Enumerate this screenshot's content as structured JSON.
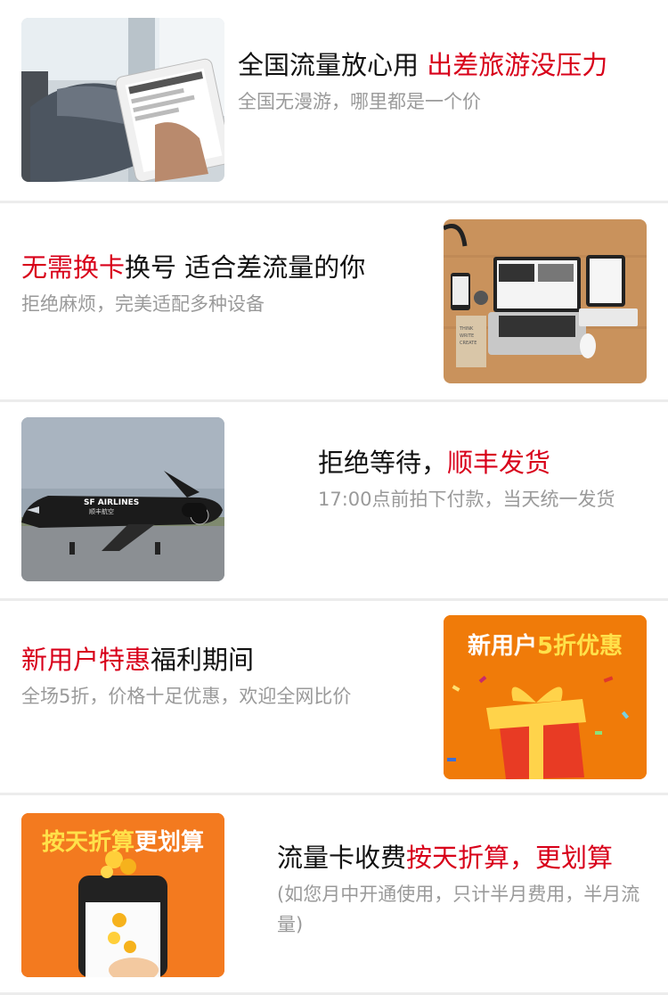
{
  "items": [
    {
      "title_plain": "全国流量放心用 ",
      "title_highlight": "出差旅游没压力",
      "subtitle": "全国无漫游，哪里都是一个价",
      "image_icon": "tablet-reading-icon",
      "accent_color": "#d8001a"
    },
    {
      "title_highlight": "无需换卡",
      "title_plain": "换号 适合差流量的你",
      "subtitle": "拒绝麻烦，完美适配多种设备",
      "image_icon": "devices-desk-icon",
      "image_caption": "THINK WRITE CREATE"
    },
    {
      "title_plain": "拒绝等待，",
      "title_highlight": "顺丰发货",
      "subtitle": "17:00点前拍下付款，当天统一发货",
      "image_icon": "sf-airlines-plane-icon",
      "image_caption": "SF AIRLINES 顺丰航空"
    },
    {
      "title_highlight": "新用户特惠",
      "title_plain": "福利期间",
      "subtitle": "全场5折，价格十足优惠，欢迎全网比价",
      "image_icon": "gift-box-icon",
      "image_banner_a": "新用户",
      "image_banner_b": "5折优惠",
      "image_bg": "#f07b09"
    },
    {
      "title_plain": "流量卡收费",
      "title_highlight": "按天折算，更划算",
      "subtitle": "(如您月中开通使用，只计半月费用，半月流量)",
      "image_icon": "phone-coins-icon",
      "image_banner_a": "按天折算",
      "image_banner_b": "更划算",
      "image_bg": "#f37a1f"
    }
  ]
}
